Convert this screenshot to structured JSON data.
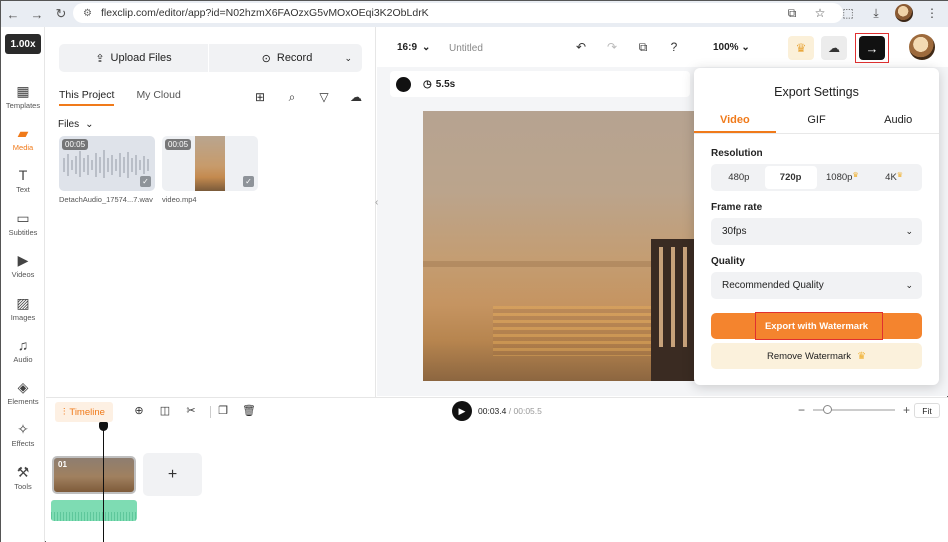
{
  "browser": {
    "url": "flexclip.com/editor/app?id=N02hzmX6FAOzxG5vMOxOEqi3K2ObLdrK",
    "nav_icons": [
      "back-arrow-icon",
      "forward-arrow-icon",
      "reload-icon",
      "site-settings-icon"
    ]
  },
  "rail": {
    "zoom": "1.00x",
    "items": [
      {
        "label": "Templates",
        "icon": "templates-icon"
      },
      {
        "label": "Media",
        "icon": "media-icon",
        "active": true
      },
      {
        "label": "Text",
        "icon": "text-icon"
      },
      {
        "label": "Subtitles",
        "icon": "subtitles-icon"
      },
      {
        "label": "Videos",
        "icon": "videos-icon"
      },
      {
        "label": "Images",
        "icon": "images-icon"
      },
      {
        "label": "Audio",
        "icon": "audio-icon"
      },
      {
        "label": "Elements",
        "icon": "elements-icon"
      },
      {
        "label": "Effects",
        "icon": "effects-icon"
      },
      {
        "label": "Tools",
        "icon": "tools-icon"
      }
    ]
  },
  "media": {
    "upload_label": "Upload Files",
    "record_label": "Record",
    "tabs": [
      "This Project",
      "My Cloud"
    ],
    "files_label": "Files",
    "files": [
      {
        "duration": "00:05",
        "name": "DetachAudio_17574...7.wav",
        "kind": "audio"
      },
      {
        "duration": "00:05",
        "name": "video.mp4",
        "kind": "video"
      }
    ]
  },
  "stage": {
    "aspect": "16:9",
    "title": "Untitled",
    "zoom": "100%",
    "duration_chip": "5.5s"
  },
  "export_panel": {
    "title": "Export Settings",
    "tabs": [
      "Video",
      "GIF",
      "Audio"
    ],
    "active_tab": "Video",
    "resolution_label": "Resolution",
    "resolutions": [
      "480p",
      "720p",
      "1080p",
      "4K"
    ],
    "selected_resolution": "720p",
    "frame_rate_label": "Frame rate",
    "frame_rate": "30fps",
    "quality_label": "Quality",
    "quality": "Recommended Quality",
    "export_button": "Export with Watermark",
    "remove_watermark": "Remove Watermark"
  },
  "timeline": {
    "label": "Timeline",
    "current_time": "00:03.4",
    "separator": "/",
    "total_time": "00:05.5",
    "fit_label": "Fit",
    "clip_number": "01",
    "add_clip": "+"
  },
  "colors": {
    "accent": "#f07a1a",
    "export_button": "#f4842e",
    "highlight_box": "#e03030",
    "audio_track": "#7edcb3"
  }
}
